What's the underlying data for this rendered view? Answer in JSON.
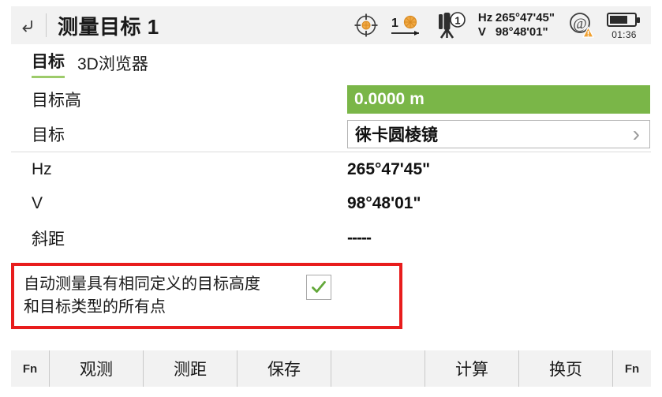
{
  "header": {
    "back_icon": "back-arrow-icon",
    "title": "测量目标 1",
    "icons": {
      "target_lock": "target-crosshair-icon",
      "prism_offset": "prism-offset-icon",
      "prism_offset_number": "1",
      "instrument": "instrument-tripod-icon",
      "instrument_number": "1",
      "connection": "at-sign-warning-icon",
      "battery": "battery-icon"
    },
    "hz_label": "Hz",
    "hz_value": "265°47'45\"",
    "v_label": "V",
    "v_value": "98°48'01\"",
    "battery_time": "01:36"
  },
  "tabs": [
    {
      "label": "目标",
      "active": true
    },
    {
      "label": "3D浏览器",
      "active": false
    }
  ],
  "form": {
    "rows": [
      {
        "label": "目标高",
        "value": "0.0000 m",
        "style": "green"
      },
      {
        "label": "目标",
        "value": "徕卡圆棱镜",
        "style": "dropdown",
        "chevron": "chevron-right-icon"
      },
      {
        "label": "Hz",
        "value": "265°47'45\"",
        "style": "plain"
      },
      {
        "label": "V",
        "value": "98°48'01\"",
        "style": "plain"
      },
      {
        "label": "斜距",
        "value": "-----",
        "style": "dash"
      }
    ]
  },
  "checkbox_block": {
    "text_line1": "自动测量具有相同定义的目标高度",
    "text_line2": "和目标类型的所有点",
    "checked": true,
    "check_icon": "checkmark-icon",
    "highlight_color": "#e81c1c"
  },
  "toolbar": {
    "fn_left": "Fn",
    "buttons": [
      "观测",
      "测距",
      "保存",
      "",
      "计算",
      "换页"
    ],
    "fn_right": "Fn"
  },
  "colors": {
    "accent_green": "#7ab648",
    "tab_underline": "#9dcb6a",
    "header_bg": "#f2f2f2",
    "annotation_red": "#e81c1c",
    "orange": "#e8962e"
  }
}
